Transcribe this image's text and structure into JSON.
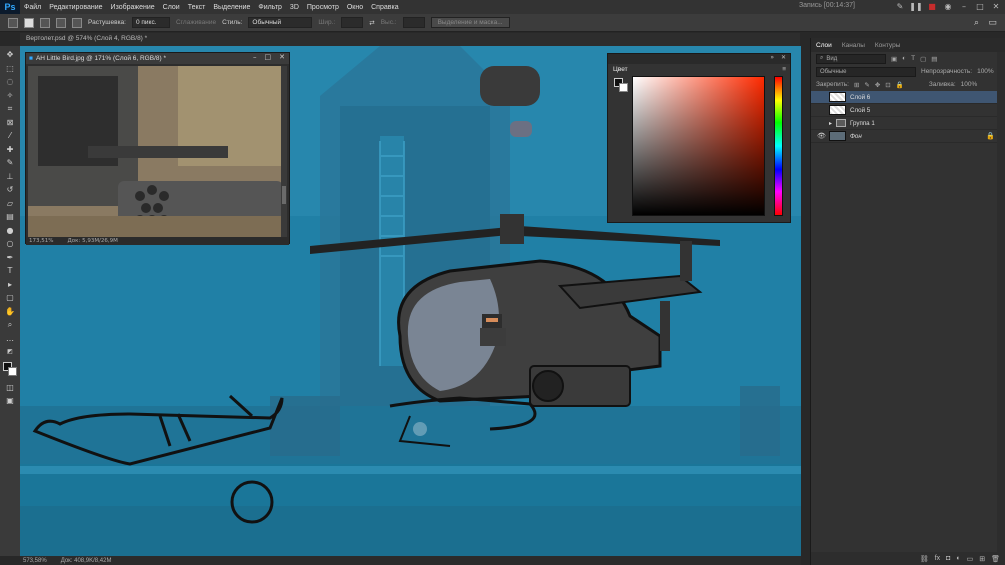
{
  "menu": {
    "logo": "Ps",
    "items": [
      "Файл",
      "Редактирование",
      "Изображение",
      "Слои",
      "Текст",
      "Выделение",
      "Фильтр",
      "3D",
      "Просмотр",
      "Окно",
      "Справка"
    ],
    "recording": "Запись [00:14:37]"
  },
  "options": {
    "feather_label": "Растушевка:",
    "feather_value": "0 пикс.",
    "antialias_label": "Сглаживание",
    "style_label": "Стиль:",
    "style_value": "Обычный",
    "width_label": "Шир.:",
    "height_label": "Выс.:",
    "select_mask_label": "Выделение и маска..."
  },
  "document": {
    "tab_title": "Вертолет.psd @ 574% (Слой 4, RGB/8) *",
    "zoom": "573,58%",
    "doc_size": "Док: 408,9K/8,42M"
  },
  "reference_window": {
    "title": "AH Little Bird.jpg @ 171% (Слой 6, RGB/8) *",
    "zoom": "173,51%",
    "doc_size": "Док: 5,93M/26,9M"
  },
  "color_panel": {
    "title": "Цвет"
  },
  "layers_panel": {
    "tabs": [
      "Слои",
      "Каналы",
      "Контуры"
    ],
    "filter_label": "Вид",
    "blend_mode": "Обычные",
    "opacity_label": "Непрозрачность:",
    "opacity_value": "100%",
    "lock_label": "Закрепить:",
    "fill_label": "Заливка:",
    "fill_value": "100%",
    "layers": [
      {
        "name": "Слой 6",
        "selected": true
      },
      {
        "name": "Слой 5",
        "selected": false
      },
      {
        "name": "Группа 1",
        "selected": false
      },
      {
        "name": "Фон",
        "selected": false
      }
    ]
  },
  "colors": {
    "canvas_bg": "#1e7ea3",
    "selected_layer": "#3f5672",
    "brand": "#31a8ff"
  }
}
